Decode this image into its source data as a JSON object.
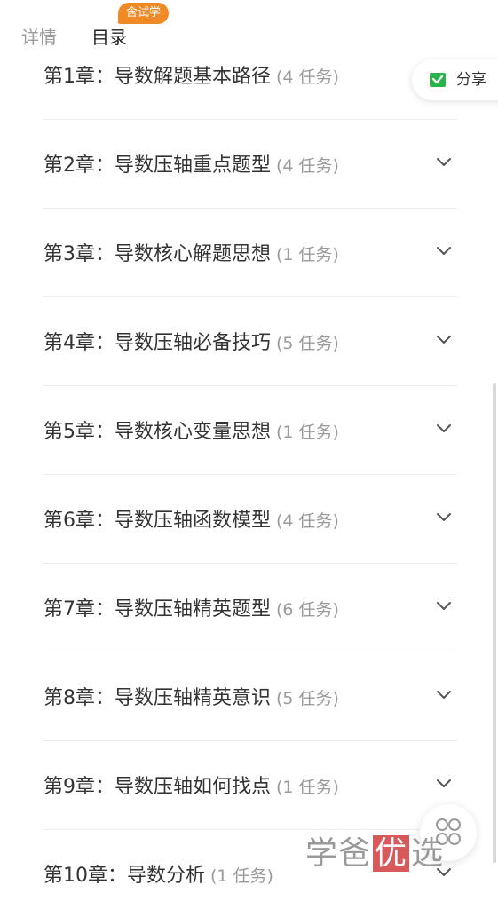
{
  "tabs": {
    "details_label": "详情",
    "catalog_label": "目录",
    "badge": "含试学"
  },
  "share": {
    "label": "分享",
    "icon": "share-icon",
    "icon_color": "#2bb24c"
  },
  "chapters": [
    {
      "title": "第1章：导数解题基本路径",
      "count": "(4 任务)"
    },
    {
      "title": "第2章：导数压轴重点题型",
      "count": "(4 任务)"
    },
    {
      "title": "第3章：导数核心解题思想",
      "count": "(1 任务)"
    },
    {
      "title": "第4章：导数压轴必备技巧",
      "count": "(5 任务)"
    },
    {
      "title": "第5章：导数核心变量思想",
      "count": "(1 任务)"
    },
    {
      "title": "第6章：导数压轴函数模型",
      "count": "(4 任务)"
    },
    {
      "title": "第7章：导数压轴精英题型",
      "count": "(6 任务)"
    },
    {
      "title": "第8章：导数压轴精英意识",
      "count": "(5 任务)"
    },
    {
      "title": "第9章：导数压轴如何找点",
      "count": "(1 任务)"
    },
    {
      "title": "第10章：导数分析",
      "count": "(1 任务)"
    }
  ],
  "watermark": {
    "part1": "学爸",
    "part2": "优",
    "part3": "选"
  },
  "colors": {
    "accent": "#f08a24",
    "text": "#333333",
    "muted": "#9a9a9a"
  }
}
